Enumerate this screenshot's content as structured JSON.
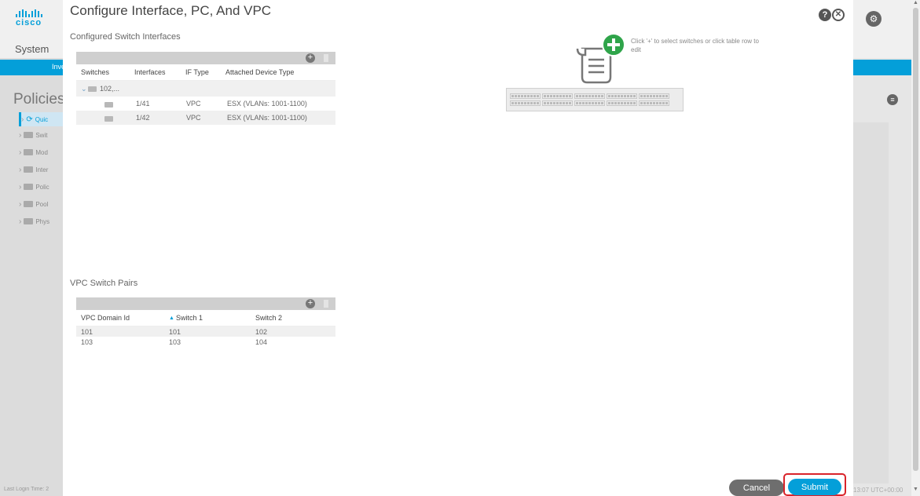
{
  "bg_left": {
    "logo_text": "cisco",
    "system_label": "System",
    "tab_label": "Inve",
    "policies_label": "Policies",
    "nav_items": [
      {
        "label": "Quic"
      },
      {
        "label": "Swit"
      },
      {
        "label": "Mod"
      },
      {
        "label": "Inter"
      },
      {
        "label": "Polic"
      },
      {
        "label": "Pool"
      },
      {
        "label": "Phys"
      }
    ],
    "last_login": "Last Login Time: 2"
  },
  "bg_right": {
    "time": "13:07 UTC+00:00"
  },
  "modal": {
    "title": "Configure Interface, PC, And VPC",
    "configured_label": "Configured Switch Interfaces",
    "interfaces_table": {
      "headers": [
        "Switches",
        "Interfaces",
        "IF Type",
        "Attached Device Type"
      ],
      "group_label": "102,...",
      "rows": [
        {
          "interface": "1/41",
          "if_type": "VPC",
          "device": "ESX (VLANs: 1001-1100)"
        },
        {
          "interface": "1/42",
          "if_type": "VPC",
          "device": "ESX (VLANs: 1001-1100)"
        }
      ]
    },
    "vpc_label": "VPC Switch Pairs",
    "vpc_table": {
      "headers": [
        "VPC Domain Id",
        "Switch 1",
        "Switch 2"
      ],
      "rows": [
        {
          "domain": "101",
          "sw1": "101",
          "sw2": "102"
        },
        {
          "domain": "103",
          "sw1": "103",
          "sw2": "104"
        }
      ]
    },
    "hint_text": "Click '+' to select switches or click table row to edit",
    "cancel_label": "Cancel",
    "submit_label": "Submit"
  }
}
